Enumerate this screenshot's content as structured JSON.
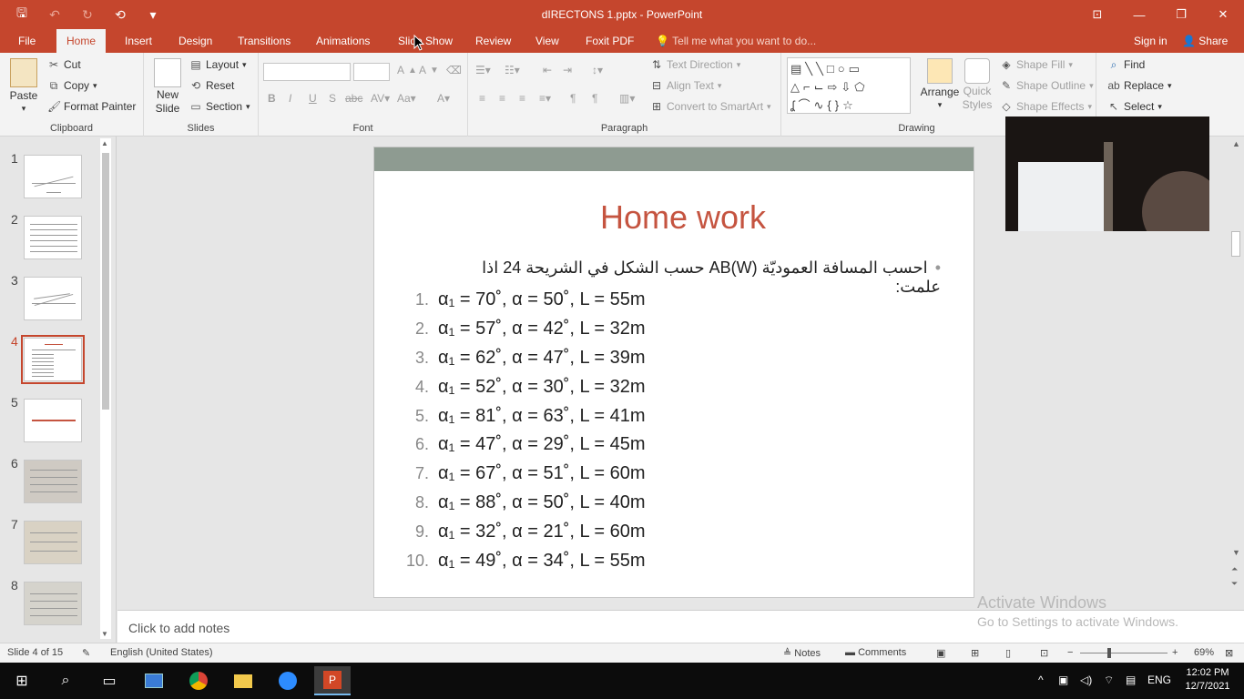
{
  "window": {
    "title": "dIRECTONS 1.pptx - PowerPoint",
    "controls": [
      "⊡",
      "—",
      "❐",
      "✕"
    ]
  },
  "qat": {
    "save": "🖫",
    "undo": "↶",
    "redo": "↻",
    "present": "⟲",
    "more": "▾"
  },
  "tabs": [
    "File",
    "Home",
    "Insert",
    "Design",
    "Transitions",
    "Animations",
    "Slide Show",
    "Review",
    "View",
    "Foxit PDF"
  ],
  "tellme": "Tell me what you want to do...",
  "signin": "Sign in",
  "share": "Share",
  "ribbon": {
    "clipboard": {
      "paste": "Paste",
      "cut": "Cut",
      "copy": "Copy",
      "format_painter": "Format Painter",
      "label": "Clipboard"
    },
    "slides": {
      "new_slide": "New",
      "new_slide2": "Slide",
      "layout": "Layout",
      "reset": "Reset",
      "section": "Section",
      "label": "Slides"
    },
    "font": {
      "label": "Font",
      "bold": "B",
      "italic": "I",
      "underline": "U",
      "shadow": "S",
      "strike": "abc"
    },
    "paragraph": {
      "label": "Paragraph",
      "text_direction": "Text Direction",
      "align_text": "Align Text",
      "smartart": "Convert to SmartArt"
    },
    "drawing": {
      "label": "Drawing",
      "arrange": "Arrange",
      "quick_styles": "Quick",
      "quick_styles2": "Styles",
      "shape_fill": "Shape Fill",
      "shape_outline": "Shape Outline",
      "shape_effects": "Shape Effects"
    },
    "editing": {
      "find": "Find",
      "replace": "Replace",
      "select": "Select"
    }
  },
  "thumbs": [
    "1",
    "2",
    "3",
    "4",
    "5",
    "6",
    "7",
    "8"
  ],
  "selected_slide": 4,
  "slide": {
    "title": "Home work",
    "bullet": "احسب المسافة العموديّة AB(W) حسب الشكل في الشريحة 24 اذا علمت:",
    "items": [
      {
        "n": "1.",
        "text": "α₁ = 70˚, α = 50˚, L = 55m"
      },
      {
        "n": "2.",
        "text": "α₁ = 57˚, α = 42˚, L = 32m"
      },
      {
        "n": "3.",
        "text": "α₁ = 62˚, α = 47˚, L = 39m"
      },
      {
        "n": "4.",
        "text": "α₁ = 52˚, α = 30˚, L = 32m"
      },
      {
        "n": "5.",
        "text": "α₁ = 81˚, α = 63˚, L = 41m"
      },
      {
        "n": "6.",
        "text": "α₁ = 47˚, α = 29˚, L = 45m"
      },
      {
        "n": "7.",
        "text": "α₁ = 67˚, α = 51˚, L = 60m"
      },
      {
        "n": "8.",
        "text": "α₁ = 88˚, α = 50˚, L = 40m"
      },
      {
        "n": "9.",
        "text": "α₁ = 32˚, α = 21˚, L = 60m"
      },
      {
        "n": "10.",
        "text": "α₁ = 49˚, α = 34˚, L = 55m"
      }
    ]
  },
  "notes_placeholder": "Click to add notes",
  "activate": {
    "line1": "Activate Windows",
    "line2": "Go to Settings to activate Windows."
  },
  "status": {
    "slide_of": "Slide 4 of 15",
    "language": "English (United States)",
    "notes": "Notes",
    "comments": "Comments",
    "zoom": "69%"
  },
  "taskbar": {
    "lang": "ENG",
    "time": "12:02 PM",
    "date": "12/7/2021"
  }
}
